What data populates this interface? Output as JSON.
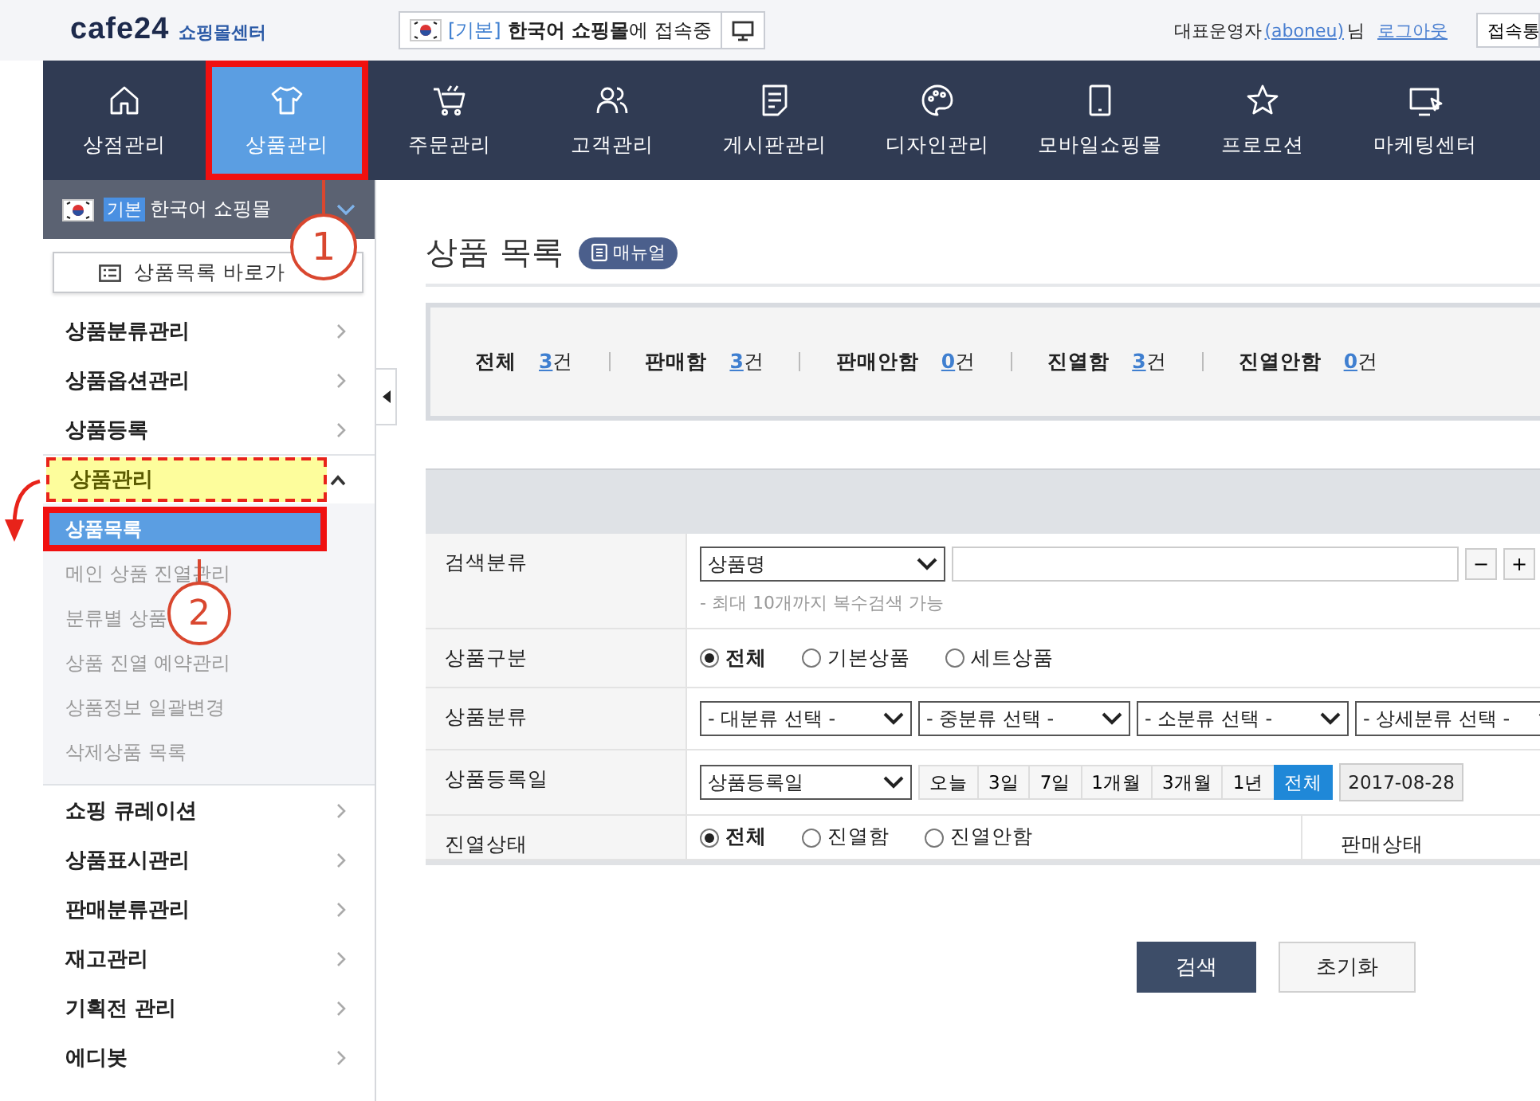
{
  "header": {
    "logo": "cafe24",
    "logo_sub": "쇼핑몰센터",
    "shop_tag": "[기본]",
    "shop_name": "한국어 쇼핑몰",
    "shop_suffix": "에 접속중",
    "user_role": "대표운영자",
    "user_id": "(aboneu)",
    "user_suffix": "님",
    "logout": "로그아웃",
    "connect_button": "접속통"
  },
  "nav": [
    {
      "label": "상점관리",
      "selected": false,
      "highlighted": false
    },
    {
      "label": "상품관리",
      "selected": true,
      "highlighted": true
    },
    {
      "label": "주문관리",
      "selected": false,
      "highlighted": false
    },
    {
      "label": "고객관리",
      "selected": false,
      "highlighted": false
    },
    {
      "label": "게시판관리",
      "selected": false,
      "highlighted": false
    },
    {
      "label": "디자인관리",
      "selected": false,
      "highlighted": false
    },
    {
      "label": "모바일쇼핑몰",
      "selected": false,
      "highlighted": false
    },
    {
      "label": "프로모션",
      "selected": false,
      "highlighted": false
    },
    {
      "label": "마케팅센터",
      "selected": false,
      "highlighted": false
    }
  ],
  "sidebar": {
    "shop_tag": "기본",
    "shop_name": "한국어 쇼핑몰",
    "shortcut": "상품목록 바로가",
    "items": [
      {
        "label": "상품분류관리",
        "kind": "link",
        "highlighted": false
      },
      {
        "label": "상품옵션관리",
        "kind": "link",
        "highlighted": false
      },
      {
        "label": "상품등록",
        "kind": "link",
        "highlighted": false
      },
      {
        "label": "상품관리",
        "kind": "group",
        "expanded": true,
        "highlighted": true,
        "children": [
          {
            "label": "상품목록",
            "selected": true,
            "highlighted": true
          },
          {
            "label": "메인 상품 진열관리",
            "selected": false,
            "highlighted": false
          },
          {
            "label": "분류별 상품",
            "selected": false,
            "highlighted": false
          },
          {
            "label": "상품 진열 예약관리",
            "selected": false,
            "highlighted": false
          },
          {
            "label": "상품정보 일괄변경",
            "selected": false,
            "highlighted": false
          },
          {
            "label": "삭제상품 목록",
            "selected": false,
            "highlighted": false
          }
        ]
      },
      {
        "label": "쇼핑 큐레이션",
        "kind": "link",
        "highlighted": false
      },
      {
        "label": "상품표시관리",
        "kind": "link",
        "highlighted": false
      },
      {
        "label": "판매분류관리",
        "kind": "link",
        "highlighted": false
      },
      {
        "label": "재고관리",
        "kind": "link",
        "highlighted": false
      },
      {
        "label": "기획전 관리",
        "kind": "link",
        "highlighted": false
      },
      {
        "label": "에디봇",
        "kind": "link",
        "highlighted": false
      }
    ]
  },
  "annotations": [
    {
      "label": "1"
    },
    {
      "label": "2"
    }
  ],
  "page": {
    "title": "상품 목록",
    "manual_button": "매뉴얼"
  },
  "stats": [
    {
      "label": "전체",
      "count": "3",
      "unit": "건"
    },
    {
      "label": "판매함",
      "count": "3",
      "unit": "건"
    },
    {
      "label": "판매안함",
      "count": "0",
      "unit": "건"
    },
    {
      "label": "진열함",
      "count": "3",
      "unit": "건"
    },
    {
      "label": "진열안함",
      "count": "0",
      "unit": "건"
    }
  ],
  "form": [
    {
      "label": "검색분류",
      "kind": "search",
      "select": "상품명",
      "hint": "- 최대 10개까지 복수검색 가능",
      "buttons": [
        "−",
        "+"
      ]
    },
    {
      "label": "상품구분",
      "kind": "radio",
      "options": [
        {
          "label": "전체",
          "selected": true
        },
        {
          "label": "기본상품",
          "selected": false
        },
        {
          "label": "세트상품",
          "selected": false
        }
      ]
    },
    {
      "label": "상품분류",
      "kind": "selects",
      "selects": [
        "- 대분류 선택 -",
        "- 중분류 선택 -",
        "- 소분류 선택 -",
        "- 상세분류 선택 -"
      ]
    },
    {
      "label": "상품등록일",
      "kind": "date",
      "select": "상품등록일",
      "periods": [
        {
          "label": "오늘",
          "selected": false
        },
        {
          "label": "3일",
          "selected": false
        },
        {
          "label": "7일",
          "selected": false
        },
        {
          "label": "1개월",
          "selected": false
        },
        {
          "label": "3개월",
          "selected": false
        },
        {
          "label": "1년",
          "selected": false
        },
        {
          "label": "전체",
          "selected": true
        }
      ],
      "date": "2017-08-28"
    },
    {
      "label": "진열상태",
      "kind": "radio",
      "options": [
        {
          "label": "전체",
          "selected": true
        },
        {
          "label": "진열함",
          "selected": false
        },
        {
          "label": "진열안함",
          "selected": false
        }
      ],
      "side_label": "판매상태"
    }
  ],
  "buttons": [
    {
      "label": "검색",
      "kind": "primary"
    },
    {
      "label": "초기화",
      "kind": "secondary"
    }
  ]
}
